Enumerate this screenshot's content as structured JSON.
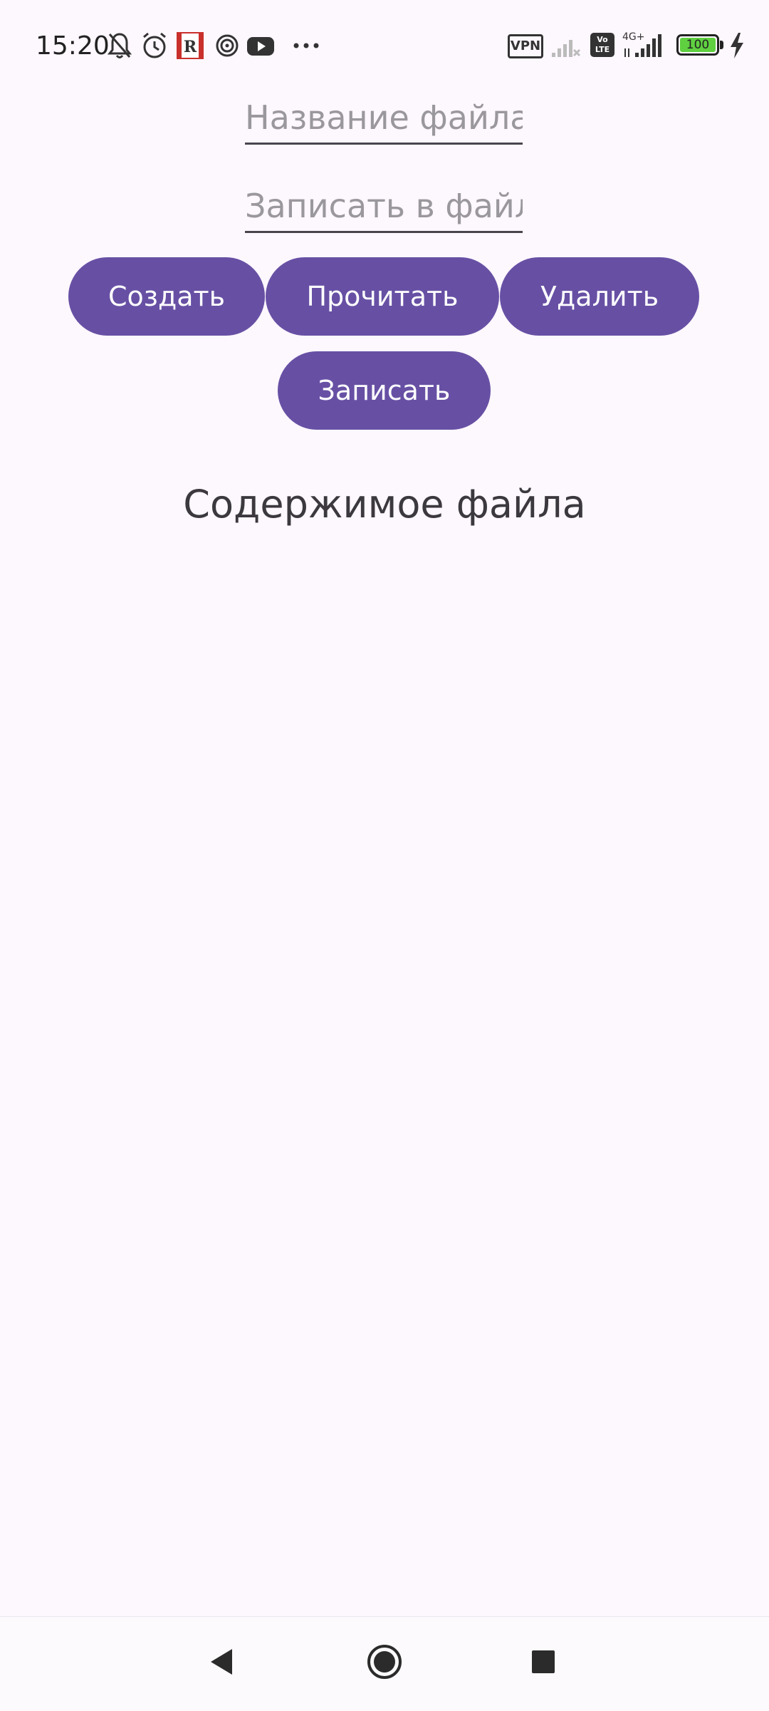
{
  "status_bar": {
    "time": "15:20",
    "icons": [
      "mute-bell-icon",
      "alarm-icon",
      "app-r-icon",
      "spiral-icon",
      "youtube-icon",
      "more-dots-icon"
    ],
    "vpn_label": "VPN",
    "volte_label": "Vo\nLTE",
    "network_label": "4G+",
    "battery_level": "100"
  },
  "form": {
    "filename_placeholder": "Название файла",
    "filename_value": "",
    "content_placeholder": "Записать в файл",
    "content_value": ""
  },
  "buttons": {
    "create": "Создать",
    "read": "Прочитать",
    "delete": "Удалить",
    "write": "Записать"
  },
  "file_content_label": "Содержимое файла",
  "nav_bar": {
    "icons": [
      "back-icon",
      "home-icon",
      "recents-icon"
    ]
  },
  "colors": {
    "background": "#fdf7fe",
    "button": "#6750a4",
    "button_text": "#ffffff",
    "battery": "#5fd040"
  }
}
